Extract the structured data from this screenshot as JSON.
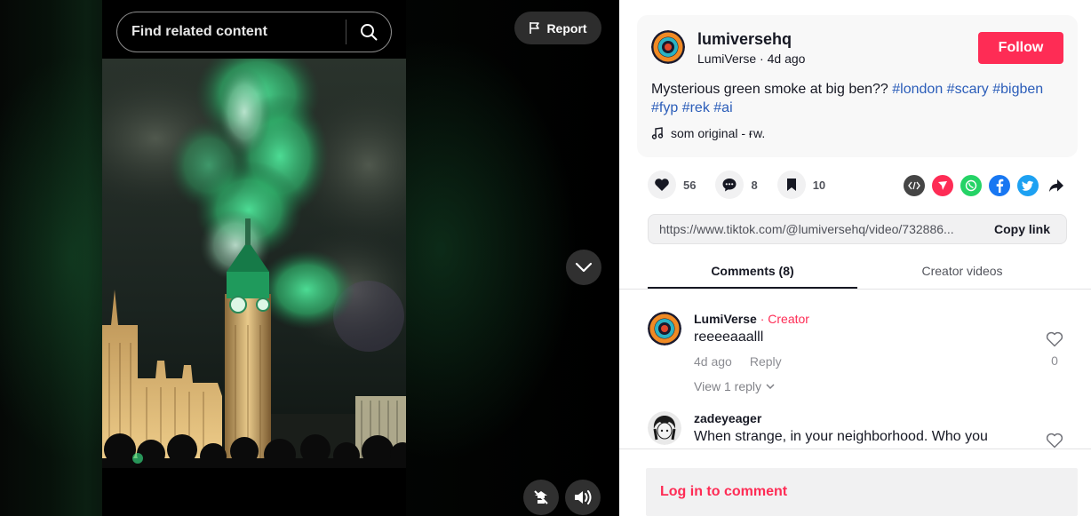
{
  "video": {
    "search_placeholder": "Find related content",
    "report_label": "Report"
  },
  "post": {
    "username": "lumiversehq",
    "display_name": "LumiVerse",
    "separator": " · ",
    "posted": "4d ago",
    "follow_label": "Follow",
    "caption_text": "Mysterious green smoke at big ben?? ",
    "hashtags": [
      "#london",
      "#scary",
      "#bigben",
      "#fyp",
      "#rek",
      "#ai"
    ],
    "music": "som original - ғw."
  },
  "stats": {
    "likes": "56",
    "comments": "8",
    "saves": "10"
  },
  "share": {
    "url": "https://www.tiktok.com/@lumiversehq/video/732886...",
    "copy_label": "Copy link"
  },
  "tabs": {
    "comments": "Comments (8)",
    "creator_videos": "Creator videos"
  },
  "comments": [
    {
      "name": "LumiVerse",
      "badge_sep": " · ",
      "badge": "Creator",
      "text": "reeeeaaalll",
      "time": "4d ago",
      "reply_label": "Reply",
      "likes": "0",
      "view_replies": "View 1 reply"
    },
    {
      "name": "zadeyeager",
      "text": "When strange, in your neighborhood. Who you"
    }
  ],
  "login_prompt": "Log in to comment",
  "colors": {
    "accent": "#fe2c55",
    "hashtag": "#2b5db9",
    "smoke": "#2fd17a"
  }
}
